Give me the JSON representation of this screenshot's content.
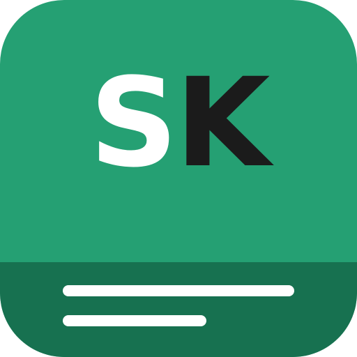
{
  "icon": {
    "letters": {
      "first": "S",
      "second": "K"
    },
    "colors": {
      "background": "#25a073",
      "band": "#177150",
      "first_letter": "#ffffff",
      "second_letter": "#1b1b1b",
      "lines": "#ffffff"
    },
    "decoration": [
      "text-line-icon",
      "text-line-icon"
    ]
  }
}
